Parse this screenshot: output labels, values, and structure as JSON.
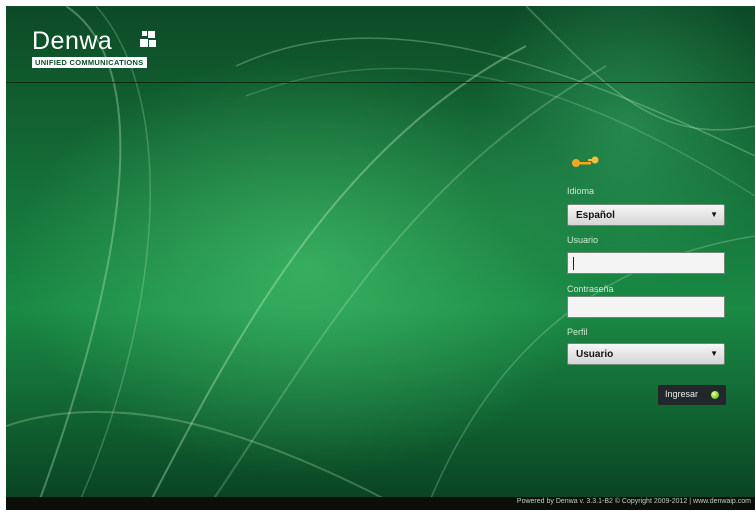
{
  "brand": {
    "name": "Denwa",
    "tagline": "UNIFIED COMMUNICATIONS"
  },
  "icons": {
    "login": "keys-icon",
    "submit": "green-dot-icon"
  },
  "login": {
    "language_label": "Idioma",
    "language_value": "Español",
    "user_label": "Usuario",
    "user_value": "",
    "password_label": "Contraseña",
    "password_value": "",
    "profile_label": "Perfil",
    "profile_value": "Usuario",
    "submit_label": "Ingresar"
  },
  "footer": {
    "text": "Powered by Denwa v. 3.3.1-B2 © Copyright 2009-2012 | www.denwaip.com"
  },
  "colors": {
    "accent": "#1a8a45",
    "button": "#21272a",
    "status": "#7ed321"
  }
}
